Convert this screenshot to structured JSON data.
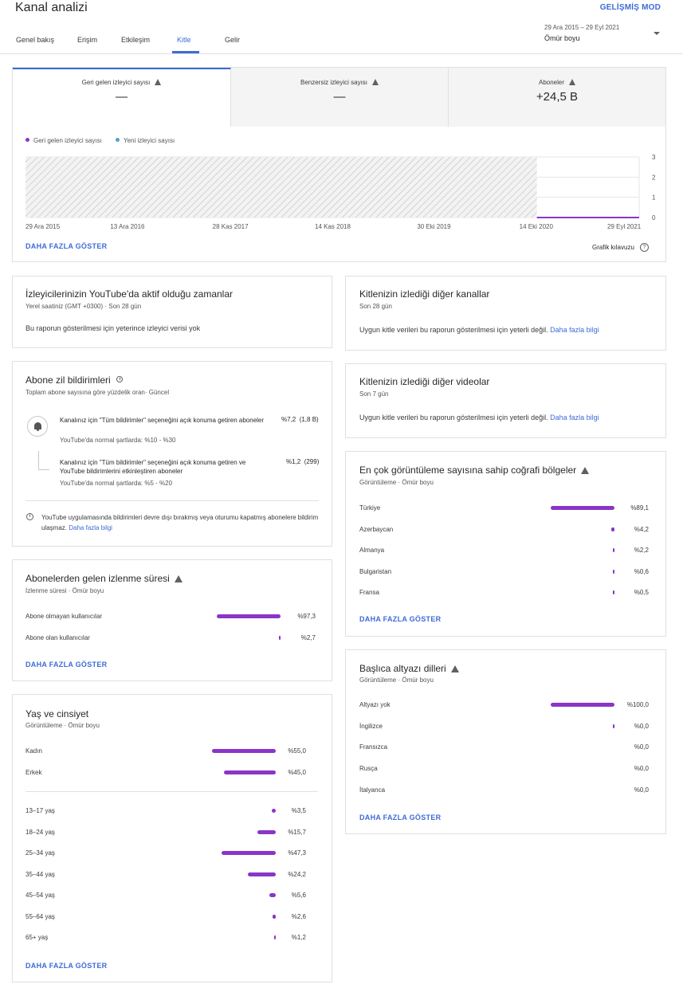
{
  "header": {
    "title": "Kanal analizi",
    "advanced_mode": "GELİŞMİŞ MOD",
    "tabs": [
      "Genel bakış",
      "Erişim",
      "Etkileşim",
      "Kitle",
      "Gelir"
    ],
    "active_tab": "Kitle",
    "date_range": "29 Ara 2015 – 29 Eyl 2021",
    "date_selection": "Ömür boyu",
    "accent_color": "#3e6bd6"
  },
  "metrics": {
    "tabs": [
      {
        "label": "Geri gelen izleyici sayısı",
        "value": "—"
      },
      {
        "label": "Benzersiz izleyici sayısı",
        "value": "—"
      },
      {
        "label": "Aboneler",
        "value": "+24,5 B"
      }
    ],
    "more_label": "DAHA FAZLA GÖSTER",
    "chart_guide": "Grafik kılavuzu",
    "help_icon": "?"
  },
  "chart_data": {
    "type": "line",
    "series": [
      {
        "name": "Geri gelen izleyici sayısı",
        "color": "#8a35c8",
        "values": [
          0,
          0
        ]
      },
      {
        "name": "Yeni izleyici sayısı",
        "color": "#4fa3c7",
        "values": []
      }
    ],
    "x_ticks": [
      "29 Ara 2015",
      "13 Ara 2016",
      "28 Kas 2017",
      "14 Kas 2018",
      "30 Eki 2019",
      "14 Eki 2020",
      "29 Eyl 2021"
    ],
    "y_ticks": [
      "0",
      "1",
      "2",
      "3"
    ],
    "ylim": [
      0,
      3
    ],
    "xlabel": "",
    "ylabel": "",
    "grid": true,
    "legend_position": "top-left",
    "unavailable_range": [
      "29 Ara 2015",
      "14 Eki 2020"
    ]
  },
  "active_times": {
    "title": "İzleyicilerinizin YouTube'da aktif olduğu zamanlar",
    "subtitle": "Yerel saatiniz (GMT +0300) · Son 28 gün",
    "message": "Bu raporun gösterilmesi için yeterince izleyici verisi yok"
  },
  "other_channels": {
    "title": "Kitlenizin izlediği diğer kanallar",
    "subtitle": "Son 28 gün",
    "message": "Uygun kitle verileri bu raporun gösterilmesi için yeterli değil.",
    "link": "Daha fazla bilgi"
  },
  "other_videos": {
    "title": "Kitlenizin izlediği diğer videolar",
    "subtitle": "Son 7 gün",
    "message": "Uygun kitle verileri bu raporun gösterilmesi için yeterli değil.",
    "link": "Daha fazla bilgi"
  },
  "bell": {
    "title": "Abone zil bildirimleri",
    "subtitle": "Toplam abone sayısına göre yüzdelik oran· Güncel",
    "rows": [
      {
        "text": "Kanalınız için \"Tüm bildirimler\" seçeneğini açık konuma getiren aboneler",
        "norm": "YouTube'da normal şartlarda: %10 - %30",
        "value": "%7,2",
        "count": "(1,8 B)"
      },
      {
        "text": "Kanalınız için \"Tüm bildirimler\" seçeneğini açık konuma getiren ve YouTube bildirimlerini etkinleştiren aboneler",
        "norm": "YouTube'da normal şartlarda: %5 - %20",
        "value": "%1,2",
        "count": "(299)"
      }
    ],
    "note": "YouTube uygulamasında bildirimleri devre dışı bırakmış veya oturumu kapatmış abonelere bildirim ulaşmaz.",
    "note_link": "Daha fazla bilgi"
  },
  "geo": {
    "title": "En çok görüntüleme sayısına sahip coğrafi bölgeler",
    "subtitle": "Görüntüleme · Ömür boyu",
    "rows": [
      {
        "label": "Türkiye",
        "value": "%89,1",
        "pct": 89.1
      },
      {
        "label": "Azerbaycan",
        "value": "%4,2",
        "pct": 4.2
      },
      {
        "label": "Almanya",
        "value": "%2,2",
        "pct": 2.2
      },
      {
        "label": "Bulgaristan",
        "value": "%0,6",
        "pct": 0.6
      },
      {
        "label": "Fransa",
        "value": "%0,5",
        "pct": 0.5
      }
    ],
    "more_label": "DAHA FAZLA GÖSTER"
  },
  "watch_time": {
    "title": "Abonelerden gelen izlenme süresi",
    "subtitle": "İzlenme süresi · Ömür boyu",
    "rows": [
      {
        "label": "Abone olmayan kullanıcılar",
        "value": "%97,3",
        "pct": 97.3
      },
      {
        "label": "Abone olan kullanıcılar",
        "value": "%2,7",
        "pct": 2.7
      }
    ],
    "more_label": "DAHA FAZLA GÖSTER"
  },
  "subtitles": {
    "title": "Başlıca altyazı dilleri",
    "subtitle": "Görüntüleme · Ömür boyu",
    "rows": [
      {
        "label": "Altyazı yok",
        "value": "%100,0",
        "pct": 100
      },
      {
        "label": "İngilizce",
        "value": "%0,0",
        "pct": 0.05
      },
      {
        "label": "Fransızca",
        "value": "%0,0",
        "pct": 0
      },
      {
        "label": "Rusça",
        "value": "%0,0",
        "pct": 0
      },
      {
        "label": "İtalyanca",
        "value": "%0,0",
        "pct": 0
      }
    ],
    "more_label": "DAHA FAZLA GÖSTER"
  },
  "age_gender": {
    "title": "Yaş ve cinsiyet",
    "subtitle": "Görüntüleme · Ömür boyu",
    "gender_rows": [
      {
        "label": "Kadın",
        "value": "%55,0",
        "pct": 55
      },
      {
        "label": "Erkek",
        "value": "%45,0",
        "pct": 45
      }
    ],
    "age_rows": [
      {
        "label": "13–17 yaş",
        "value": "%3,5",
        "pct": 3.5
      },
      {
        "label": "18–24 yaş",
        "value": "%15,7",
        "pct": 15.7
      },
      {
        "label": "25–34 yaş",
        "value": "%47,3",
        "pct": 47.3
      },
      {
        "label": "35–44 yaş",
        "value": "%24,2",
        "pct": 24.2
      },
      {
        "label": "45–54 yaş",
        "value": "%5,6",
        "pct": 5.6
      },
      {
        "label": "55–64 yaş",
        "value": "%2,6",
        "pct": 2.6
      },
      {
        "label": "65+ yaş",
        "value": "%1,2",
        "pct": 1.2
      }
    ],
    "more_label": "DAHA FAZLA GÖSTER"
  },
  "bar_color": "#8a35c8"
}
